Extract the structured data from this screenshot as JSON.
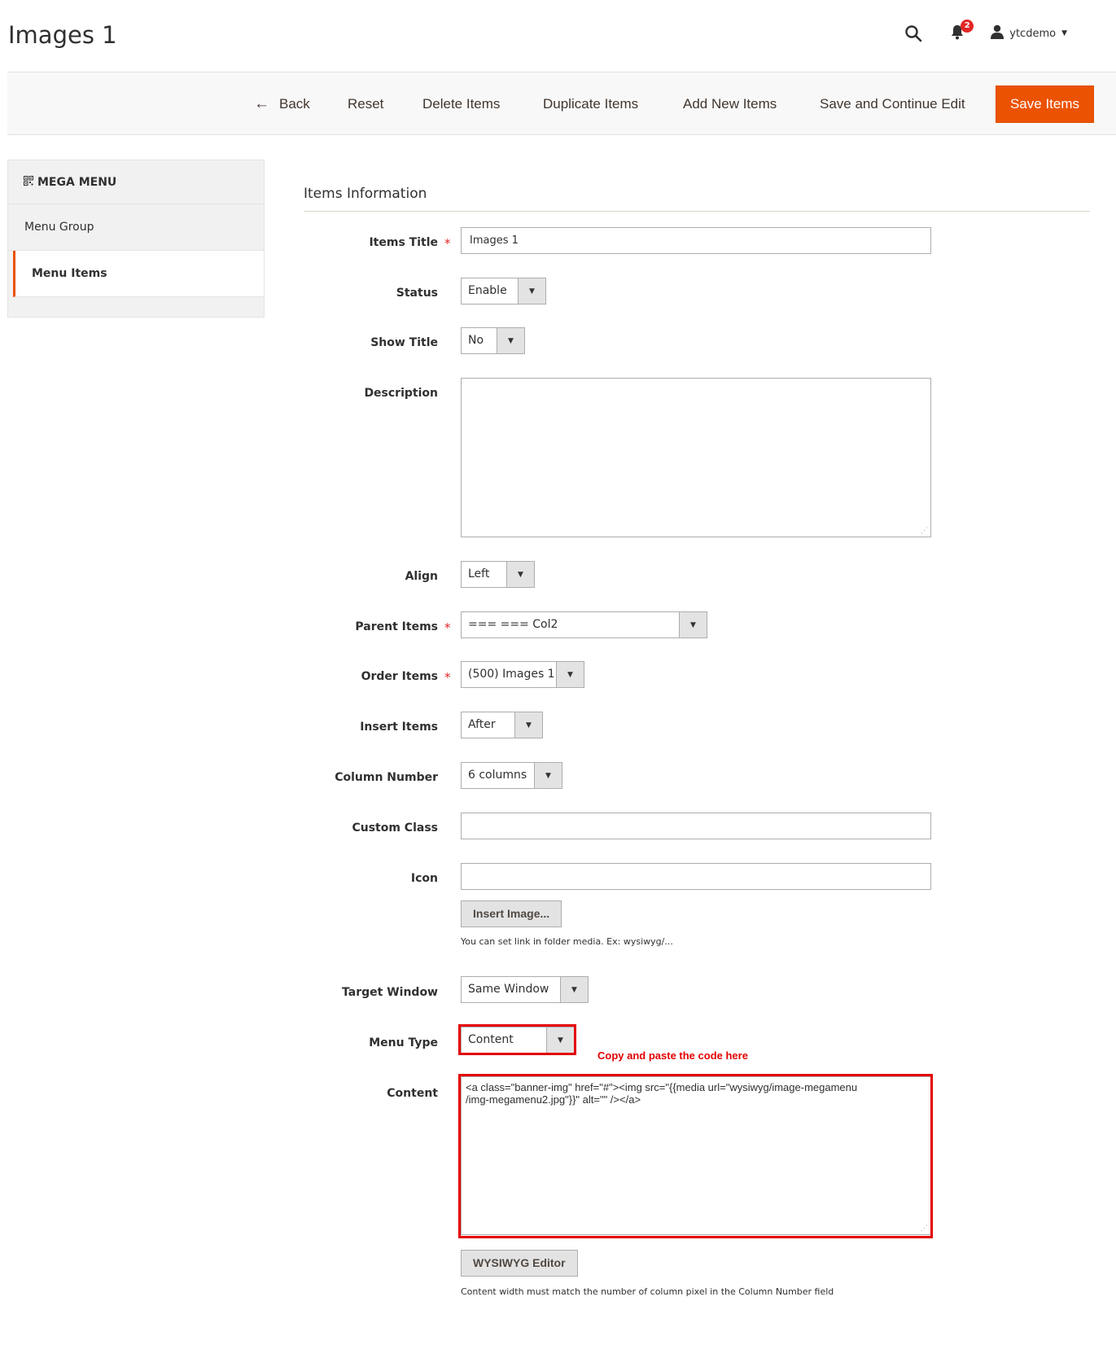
{
  "page": {
    "title": "Images 1"
  },
  "header": {
    "search_icon": "search-icon",
    "notifications": {
      "icon": "bell-icon",
      "count": "2"
    },
    "user": {
      "icon": "user-icon",
      "name": "ytcdemo"
    }
  },
  "toolbar": {
    "back_label": "Back",
    "reset_label": "Reset",
    "delete_label": "Delete Items",
    "duplicate_label": "Duplicate Items",
    "add_label": "Add New Items",
    "save_continue_label": "Save and Continue Edit",
    "save_label": "Save Items",
    "save_color": "#eb5202"
  },
  "sidebar": {
    "title": "MEGA MENU",
    "items": [
      {
        "label": "Menu Group"
      },
      {
        "label": "Menu Items"
      }
    ]
  },
  "form": {
    "section_title": "Items Information",
    "fields": {
      "items_title": {
        "label": "Items Title",
        "value": "Images 1"
      },
      "status": {
        "label": "Status",
        "value": "Enable"
      },
      "show_title": {
        "label": "Show Title",
        "value": "No"
      },
      "description": {
        "label": "Description",
        "value": ""
      },
      "align": {
        "label": "Align",
        "value": "Left"
      },
      "parent_items": {
        "label": "Parent Items",
        "value": "=== === Col2"
      },
      "order_items": {
        "label": "Order Items",
        "value": "(500) Images 1"
      },
      "insert_items": {
        "label": "Insert Items",
        "value": "After"
      },
      "column_number": {
        "label": "Column Number",
        "value": "6 columns"
      },
      "custom_class": {
        "label": "Custom Class",
        "value": ""
      },
      "icon": {
        "label": "Icon",
        "value": "",
        "button_label": "Insert Image...",
        "note": "You can set link in folder media. Ex: wysiwyg/..."
      },
      "target_window": {
        "label": "Target Window",
        "value": "Same Window"
      },
      "menu_type": {
        "label": "Menu Type",
        "value": "Content"
      },
      "content": {
        "label": "Content",
        "line1": "<a class=\"banner-img\" href=\"#\"><img src=\"{{media url=\"wysiwyg/image-megamenu",
        "line2": "/img-megamenu2.jpg\"}}\" alt=\"\" /></a>",
        "button_label": "WYSIWYG Editor",
        "note": "Content width must match the number of column pixel in the Column Number field"
      }
    }
  },
  "annotation": {
    "text": "Copy and paste the code here",
    "color": "#e30000"
  }
}
